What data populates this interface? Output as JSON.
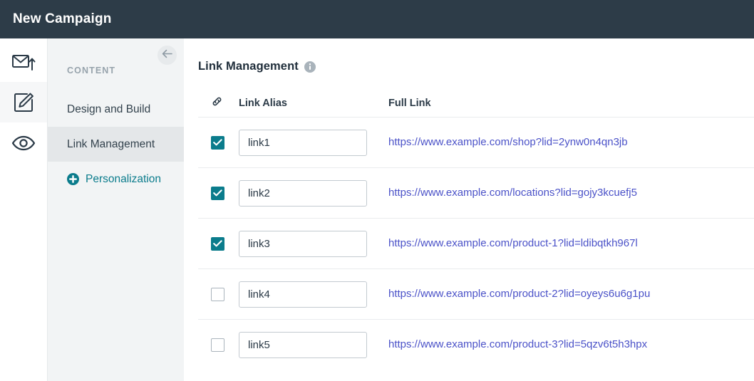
{
  "topbar": {
    "title": "New Campaign"
  },
  "rail": {
    "items": [
      {
        "icon": "envelope-up-icon",
        "name": "rail-item-send",
        "active": false
      },
      {
        "icon": "edit-square-icon",
        "name": "rail-item-design",
        "active": true
      },
      {
        "icon": "eye-icon",
        "name": "rail-item-preview",
        "active": false
      }
    ]
  },
  "sidebar": {
    "collapse_icon": "arrow-left-icon",
    "heading": "CONTENT",
    "items": [
      {
        "label": "Design and Build",
        "selected": false,
        "accent": false
      },
      {
        "label": "Link Management",
        "selected": true,
        "accent": false
      },
      {
        "label": "Personalization",
        "selected": false,
        "accent": true,
        "icon": "plus-circle-icon"
      }
    ]
  },
  "main": {
    "title": "Link Management",
    "info_icon": "info-icon",
    "table": {
      "headers": {
        "check_icon": "chain-link-icon",
        "alias": "Link Alias",
        "full_link": "Full Link"
      },
      "rows": [
        {
          "checked": true,
          "alias": "link1",
          "full_link": "https://www.example.com/shop?lid=2ynw0n4qn3jb"
        },
        {
          "checked": true,
          "alias": "link2",
          "full_link": "https://www.example.com/locations?lid=gojy3kcuefj5"
        },
        {
          "checked": true,
          "alias": "link3",
          "full_link": "https://www.example.com/product-1?lid=ldibqtkh967l"
        },
        {
          "checked": false,
          "alias": "link4",
          "full_link": "https://www.example.com/product-2?lid=oyeys6u6g1pu"
        },
        {
          "checked": false,
          "alias": "link5",
          "full_link": "https://www.example.com/product-3?lid=5qzv6t5h3hpx"
        }
      ]
    }
  },
  "colors": {
    "topbar_bg": "#2d3c48",
    "accent_teal": "#0b7c8c",
    "link_indigo": "#4b52c8",
    "sidebar_bg": "#f2f4f5",
    "selected_bg": "#e4e7e9"
  }
}
